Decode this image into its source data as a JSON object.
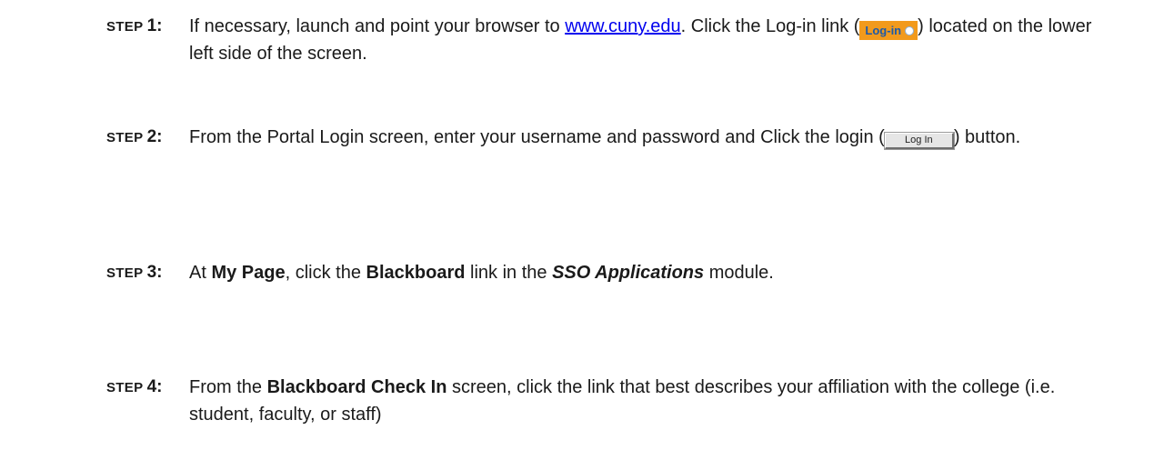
{
  "steps": [
    {
      "word": "STEP ",
      "num": "1:",
      "before_link": "If necessary, launch and point your browser to ",
      "link": "www.cuny.edu",
      "after_link": ".  Click the Log-in link (",
      "inline_link_label": "Log-in",
      "after_inline": ") located on the lower left side of the screen."
    },
    {
      "word": "STEP ",
      "num": "2:",
      "before": "From the Portal Login screen, enter your username and password and Click the login (",
      "button_label": "Log In",
      "after": ") button."
    },
    {
      "word": "STEP ",
      "num": "3:",
      "t1": "At ",
      "b1": "My Page",
      "t2": ", click the ",
      "b2": "Blackboard",
      "t3": " link in the ",
      "bi": "SSO Applications",
      "t4": " module."
    },
    {
      "word": "STEP ",
      "num": "4:",
      "t1": "From the ",
      "b1": "Blackboard Check In",
      "t2": " screen, click the link that best describes your affiliation with the college (i.e. student, faculty, or staff)"
    }
  ]
}
